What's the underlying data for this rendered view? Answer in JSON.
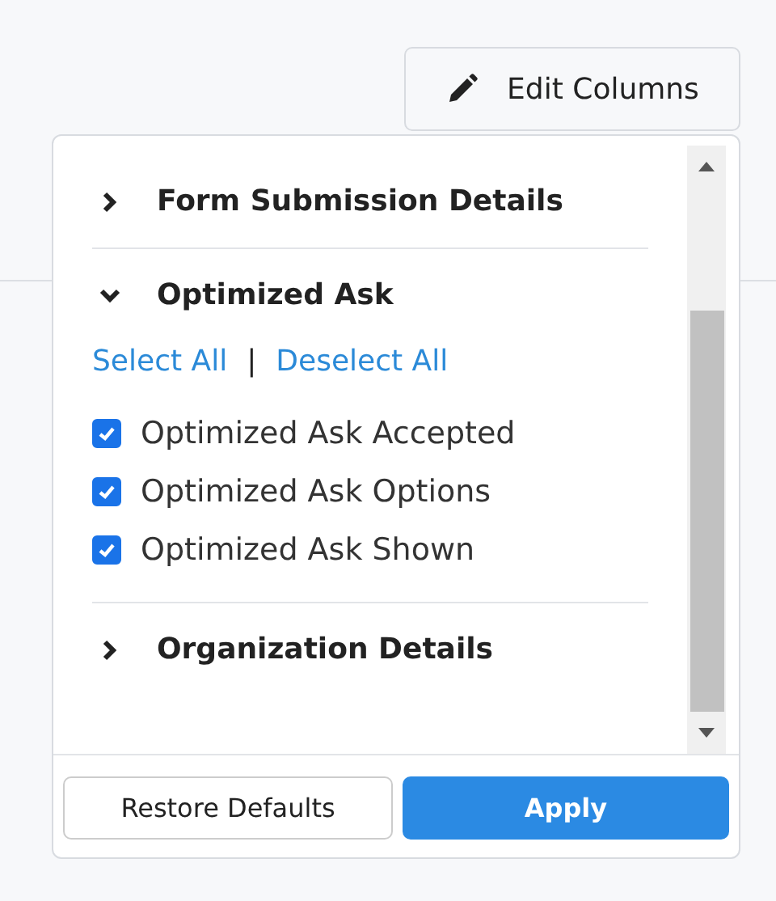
{
  "edit_button": {
    "label": "Edit Columns"
  },
  "sections": [
    {
      "title": "Form Submission Details",
      "expanded": false
    },
    {
      "title": "Optimized Ask",
      "expanded": true,
      "select_all": "Select All",
      "separator": "|",
      "deselect_all": "Deselect All",
      "items": [
        {
          "label": "Optimized Ask Accepted",
          "checked": true
        },
        {
          "label": "Optimized Ask Options",
          "checked": true
        },
        {
          "label": "Optimized Ask Shown",
          "checked": true
        }
      ]
    },
    {
      "title": "Organization Details",
      "expanded": false
    }
  ],
  "footer": {
    "restore": "Restore Defaults",
    "apply": "Apply"
  }
}
